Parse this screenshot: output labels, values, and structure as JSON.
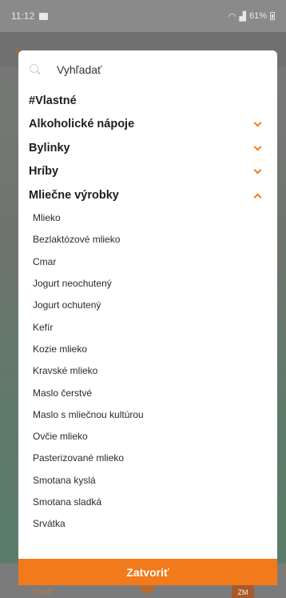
{
  "status_bar": {
    "time": "11:12",
    "battery": "61%"
  },
  "background": {
    "nav_label": "Úvod",
    "badge": "ZM"
  },
  "search": {
    "placeholder": "Vyhľadať"
  },
  "categories": [
    {
      "label": "#Vlastné",
      "chevron": "none"
    },
    {
      "label": "Alkoholické nápoje",
      "chevron": "down"
    },
    {
      "label": "Bylinky",
      "chevron": "down"
    },
    {
      "label": "Hríby",
      "chevron": "down"
    },
    {
      "label": "Mliečne výrobky",
      "chevron": "up"
    }
  ],
  "subitems": [
    "Mlieko",
    "Bezlaktózové mlieko",
    "Cmar",
    "Jogurt neochutený",
    "Jogurt ochutený",
    "Kefír",
    "Kozie mlieko",
    "Kravské mlieko",
    "Maslo čerstvé",
    "Maslo s mliečnou kultúrou",
    "Ovčie mlieko",
    "Pasterizované mlieko",
    "Smotana kyslá",
    "Smotana sladká",
    "Srvátka"
  ],
  "close_button": {
    "label": "Zatvoriť"
  },
  "colors": {
    "accent": "#f27a1a",
    "text": "#1e1e1e"
  }
}
